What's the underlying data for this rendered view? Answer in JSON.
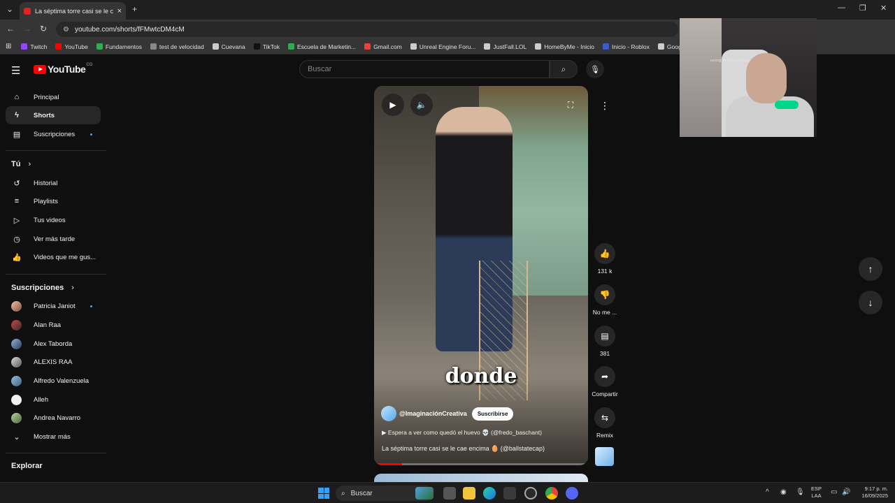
{
  "browser": {
    "tab_title": "La séptima torre casi se le cae encima",
    "url": "youtube.com/shorts/fFMwtcDM4cM",
    "bookmarks": [
      {
        "label": "Twitch",
        "color": "#9146ff"
      },
      {
        "label": "YouTube",
        "color": "#ff0000"
      },
      {
        "label": "Fundamentos",
        "color": "#34a853"
      },
      {
        "label": "test de velocidad",
        "color": "#888888"
      },
      {
        "label": "Cuevana",
        "color": "#cccccc"
      },
      {
        "label": "TikTok",
        "color": "#111111"
      },
      {
        "label": "Escuela de Marketin...",
        "color": "#34a853"
      },
      {
        "label": "Gmail.com",
        "color": "#ea4335"
      },
      {
        "label": "Unreal Engine Foru...",
        "color": "#cccccc"
      },
      {
        "label": "JustFall.LOL",
        "color": "#cccccc"
      },
      {
        "label": "HomeByMe - Inicio",
        "color": "#cccccc"
      },
      {
        "label": "Inicio - Roblox",
        "color": "#3b5ccc"
      },
      {
        "label": "Google",
        "color": "#cccccc"
      }
    ]
  },
  "header": {
    "logo_text": "YouTube",
    "country_code": "CO",
    "search_placeholder": "Buscar"
  },
  "sidebar": {
    "main": [
      {
        "label": "Principal",
        "icon": "home-icon"
      },
      {
        "label": "Shorts",
        "icon": "shorts-icon",
        "active": true
      },
      {
        "label": "Suscripciones",
        "icon": "subscriptions-icon",
        "dot": true
      }
    ],
    "you_heading": "Tú",
    "you": [
      {
        "label": "Historial",
        "icon": "history-icon"
      },
      {
        "label": "Playlists",
        "icon": "playlists-icon"
      },
      {
        "label": "Tus videos",
        "icon": "your-videos-icon"
      },
      {
        "label": "Ver más tarde",
        "icon": "watch-later-icon"
      },
      {
        "label": "Videos que me gus...",
        "icon": "liked-icon"
      }
    ],
    "subs_heading": "Suscripciones",
    "subs": [
      {
        "label": "Patricia Janiot",
        "dot": true
      },
      {
        "label": "Alan Raa"
      },
      {
        "label": "Alex Taborda"
      },
      {
        "label": "ALEXIS RAA"
      },
      {
        "label": "Alfredo Valenzuela"
      },
      {
        "label": "Alleh"
      },
      {
        "label": "Andrea Navarro"
      }
    ],
    "show_more": "Mostrar más",
    "explore_heading": "Explorar"
  },
  "short": {
    "caption": "donde",
    "channel": "@ImaginaciónCreativa",
    "subscribe": "Suscribirse",
    "sound": "Espera a ver como quedó el huevo 💀 (@fredo_baschant)",
    "title": "La séptima torre casi se le cae encima 🥚 (@ballstatecap)",
    "progress": 0.13
  },
  "actions": {
    "likes": "131 k",
    "dislike": "No me ...",
    "comments": "381",
    "share": "Compartir",
    "remix": "Remix"
  },
  "webcam": {
    "watermark": "using droidcam.app"
  },
  "taskbar": {
    "search": "Buscar",
    "lang_1": "ESP",
    "lang_2": "LAA",
    "time": "9:17 p. m.",
    "date": "16/09/2025"
  }
}
